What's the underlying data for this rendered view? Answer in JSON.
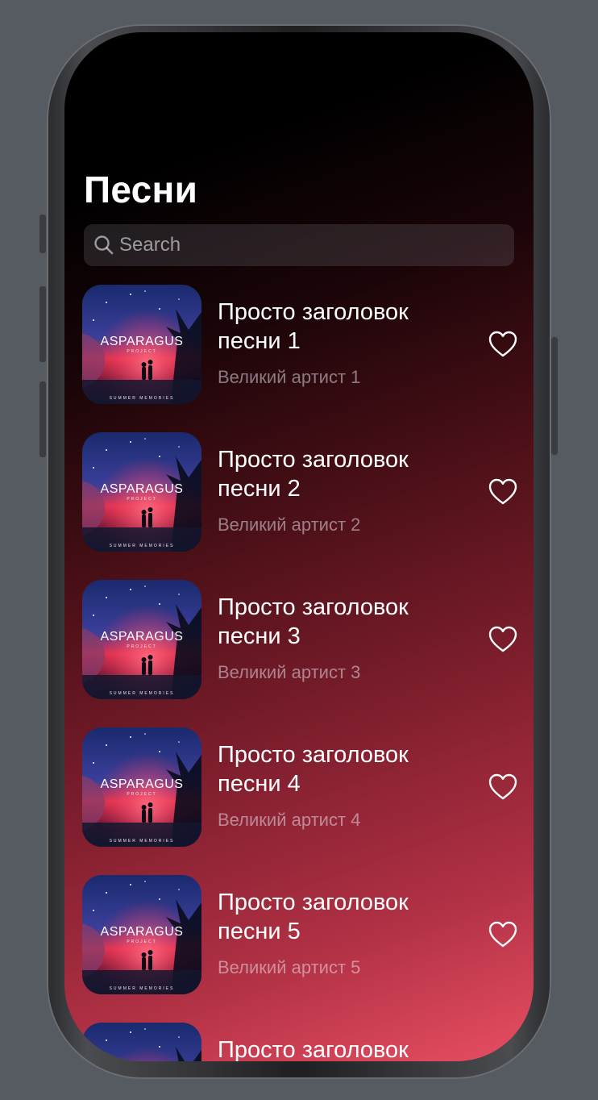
{
  "screen": {
    "title": "Песни"
  },
  "search": {
    "placeholder": "Search",
    "value": ""
  },
  "cover_art": {
    "brand": "ASPARAGUS",
    "sub": "PROJECT",
    "album": "SUMMER MEMORIES"
  },
  "songs": [
    {
      "title": "Просто заголовок песни 1",
      "artist": "Великий артист 1",
      "liked": false,
      "icon": "heart-outline"
    },
    {
      "title": "Просто заголовок песни 2",
      "artist": "Великий артист 2",
      "liked": false,
      "icon": "heart-outline"
    },
    {
      "title": "Просто заголовок песни 3",
      "artist": "Великий артист 3",
      "liked": false,
      "icon": "heart-outline"
    },
    {
      "title": "Просто заголовок песни 4",
      "artist": "Великий артист 4",
      "liked": false,
      "icon": "heart-outline"
    },
    {
      "title": "Просто заголовок песни 5",
      "artist": "Великий артист 5",
      "liked": false,
      "icon": "heart-outline"
    },
    {
      "title": "Просто заголовок"
    }
  ],
  "colors": {
    "gradient_top": "#000000",
    "gradient_bottom": "#e84e62",
    "text_primary": "#ffffff",
    "text_secondary": "#8b8b90"
  }
}
